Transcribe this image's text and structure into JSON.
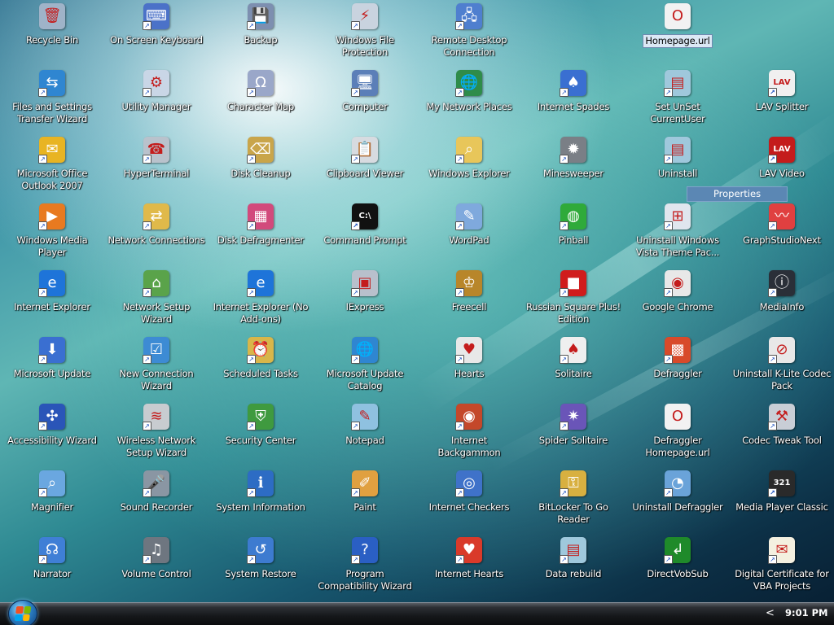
{
  "desktop": {
    "icons": [
      {
        "label": "Recycle Bin",
        "col": 0,
        "row": 0,
        "glyph": "🗑",
        "color": "#9fb3c8",
        "icon": "recycle-bin-icon",
        "shortcut": false
      },
      {
        "label": "Files and Settings Transfer Wizard",
        "col": 0,
        "row": 1,
        "glyph": "⇆",
        "color": "#2f86d1",
        "icon": "transfer-wizard-icon",
        "shortcut": true
      },
      {
        "label": "Microsoft Office Outlook 2007",
        "col": 0,
        "row": 2,
        "glyph": "✉",
        "color": "#e8b423",
        "icon": "outlook-icon",
        "shortcut": true
      },
      {
        "label": "Windows Media Player",
        "col": 0,
        "row": 3,
        "glyph": "▶",
        "color": "#e87a20",
        "icon": "media-player-icon",
        "shortcut": true
      },
      {
        "label": "Internet Explorer",
        "col": 0,
        "row": 4,
        "glyph": "e",
        "color": "#1e74d9",
        "icon": "internet-explorer-icon",
        "shortcut": true
      },
      {
        "label": "Microsoft Update",
        "col": 0,
        "row": 5,
        "glyph": "⬇",
        "color": "#3a6fd1",
        "icon": "microsoft-update-icon",
        "shortcut": true
      },
      {
        "label": "Accessibility Wizard",
        "col": 0,
        "row": 6,
        "glyph": "✣",
        "color": "#2a55b8",
        "icon": "accessibility-wizard-icon",
        "shortcut": true
      },
      {
        "label": "Magnifier",
        "col": 0,
        "row": 7,
        "glyph": "⌕",
        "color": "#6aa7e0",
        "icon": "magnifier-icon",
        "shortcut": true
      },
      {
        "label": "Narrator",
        "col": 0,
        "row": 8,
        "glyph": "☊",
        "color": "#3f7fd6",
        "icon": "narrator-icon",
        "shortcut": true
      },
      {
        "label": "On Screen Keyboard",
        "col": 1,
        "row": 0,
        "glyph": "⌨",
        "color": "#4b72c8",
        "icon": "keyboard-icon",
        "shortcut": true
      },
      {
        "label": "Utility Manager",
        "col": 1,
        "row": 1,
        "glyph": "⚙",
        "color": "#c9d6e6",
        "icon": "utility-manager-icon",
        "shortcut": true
      },
      {
        "label": "HyperTerminal",
        "col": 1,
        "row": 2,
        "glyph": "☎",
        "color": "#b9c2cc",
        "icon": "hyperterminal-icon",
        "shortcut": true
      },
      {
        "label": "Network Connections",
        "col": 1,
        "row": 3,
        "glyph": "⇄",
        "color": "#e0b94a",
        "icon": "network-connections-icon",
        "shortcut": true
      },
      {
        "label": "Network Setup Wizard",
        "col": 1,
        "row": 4,
        "glyph": "⌂",
        "color": "#5aa34a",
        "icon": "network-setup-icon",
        "shortcut": true
      },
      {
        "label": "New Connection Wizard",
        "col": 1,
        "row": 5,
        "glyph": "☑",
        "color": "#3d8bd4",
        "icon": "new-connection-icon",
        "shortcut": true
      },
      {
        "label": "Wireless Network Setup Wizard",
        "col": 1,
        "row": 6,
        "glyph": "≋",
        "color": "#c8ccd0",
        "icon": "wireless-setup-icon",
        "shortcut": true
      },
      {
        "label": "Sound Recorder",
        "col": 1,
        "row": 7,
        "glyph": "🎤",
        "color": "#8a96a3",
        "icon": "microphone-icon",
        "shortcut": true
      },
      {
        "label": "Volume Control",
        "col": 1,
        "row": 8,
        "glyph": "♫",
        "color": "#6e7680",
        "icon": "volume-control-icon",
        "shortcut": true
      },
      {
        "label": "Backup",
        "col": 2,
        "row": 0,
        "glyph": "💾",
        "color": "#7d8fb0",
        "icon": "backup-icon",
        "shortcut": true
      },
      {
        "label": "Character Map",
        "col": 2,
        "row": 1,
        "glyph": "Ω",
        "color": "#9aa7c9",
        "icon": "character-map-icon",
        "shortcut": true
      },
      {
        "label": "Disk Cleanup",
        "col": 2,
        "row": 2,
        "glyph": "⌫",
        "color": "#c9a54a",
        "icon": "disk-cleanup-icon",
        "shortcut": true
      },
      {
        "label": "Disk Defragmenter",
        "col": 2,
        "row": 3,
        "glyph": "▦",
        "color": "#d24a7c",
        "icon": "defragmenter-icon",
        "shortcut": true
      },
      {
        "label": "Internet Explorer (No Add-ons)",
        "col": 2,
        "row": 4,
        "glyph": "e",
        "color": "#1e74d9",
        "icon": "internet-explorer-icon",
        "shortcut": true
      },
      {
        "label": "Scheduled Tasks",
        "col": 2,
        "row": 5,
        "glyph": "⏰",
        "color": "#d8b64a",
        "icon": "scheduled-tasks-icon",
        "shortcut": true
      },
      {
        "label": "Security Center",
        "col": 2,
        "row": 6,
        "glyph": "⛨",
        "color": "#3f9a3f",
        "icon": "shield-icon",
        "shortcut": true
      },
      {
        "label": "System Information",
        "col": 2,
        "row": 7,
        "glyph": "ℹ",
        "color": "#2d6cc4",
        "icon": "system-information-icon",
        "shortcut": true
      },
      {
        "label": "System Restore",
        "col": 2,
        "row": 8,
        "glyph": "↺",
        "color": "#3d7bd0",
        "icon": "system-restore-icon",
        "shortcut": true
      },
      {
        "label": "Windows File Protection",
        "col": 3,
        "row": 0,
        "glyph": "⚡",
        "color": "#c9d3df",
        "icon": "file-protection-icon",
        "shortcut": true
      },
      {
        "label": "Computer",
        "col": 3,
        "row": 1,
        "glyph": "🖥",
        "color": "#5b7fb8",
        "icon": "computer-icon",
        "shortcut": true
      },
      {
        "label": "Clipboard Viewer",
        "col": 3,
        "row": 2,
        "glyph": "📋",
        "color": "#d7dbe0",
        "icon": "clipboard-icon",
        "shortcut": true
      },
      {
        "label": "Command Prompt",
        "col": 3,
        "row": 3,
        "glyph": "C:\\",
        "color": "#111111",
        "icon": "command-prompt-icon",
        "shortcut": true
      },
      {
        "label": "IExpress",
        "col": 3,
        "row": 4,
        "glyph": "▣",
        "color": "#b8c0cc",
        "icon": "iexpress-icon",
        "shortcut": true
      },
      {
        "label": "Microsoft Update Catalog",
        "col": 3,
        "row": 5,
        "glyph": "🌐",
        "color": "#2f86d1",
        "icon": "globe-icon",
        "shortcut": true
      },
      {
        "label": "Notepad",
        "col": 3,
        "row": 6,
        "glyph": "✎",
        "color": "#8fc1e0",
        "icon": "notepad-icon",
        "shortcut": true
      },
      {
        "label": "Paint",
        "col": 3,
        "row": 7,
        "glyph": "✐",
        "color": "#e0a040",
        "icon": "paint-icon",
        "shortcut": true
      },
      {
        "label": "Program Compatibility Wizard",
        "col": 3,
        "row": 8,
        "glyph": "?",
        "color": "#2a5fc4",
        "icon": "help-shield-icon",
        "shortcut": true
      },
      {
        "label": "Remote Desktop Connection",
        "col": 4,
        "row": 0,
        "glyph": "🖧",
        "color": "#4f7fcf",
        "icon": "remote-desktop-icon",
        "shortcut": true
      },
      {
        "label": "My Network Places",
        "col": 4,
        "row": 1,
        "glyph": "🌐",
        "color": "#2f8c4a",
        "icon": "network-places-icon",
        "shortcut": true
      },
      {
        "label": "Windows Explorer",
        "col": 4,
        "row": 2,
        "glyph": "⌕",
        "color": "#e8c65a",
        "icon": "explorer-icon",
        "shortcut": true
      },
      {
        "label": "WordPad",
        "col": 4,
        "row": 3,
        "glyph": "✎",
        "color": "#7fa9dd",
        "icon": "wordpad-icon",
        "shortcut": true
      },
      {
        "label": "Freecell",
        "col": 4,
        "row": 4,
        "glyph": "♔",
        "color": "#b8862a",
        "icon": "freecell-icon",
        "shortcut": true
      },
      {
        "label": "Hearts",
        "col": 4,
        "row": 5,
        "glyph": "♥",
        "color": "#e8e8e8",
        "icon": "hearts-icon",
        "shortcut": true
      },
      {
        "label": "Internet Backgammon",
        "col": 4,
        "row": 6,
        "glyph": "◉",
        "color": "#c4482a",
        "icon": "backgammon-icon",
        "shortcut": true
      },
      {
        "label": "Internet Checkers",
        "col": 4,
        "row": 7,
        "glyph": "◎",
        "color": "#3f72c9",
        "icon": "checkers-icon",
        "shortcut": true
      },
      {
        "label": "Internet Hearts",
        "col": 4,
        "row": 8,
        "glyph": "♥",
        "color": "#d93a2a",
        "icon": "internet-hearts-icon",
        "shortcut": true
      },
      {
        "label": "Internet Spades",
        "col": 5,
        "row": 1,
        "glyph": "♠",
        "color": "#3a6fd1",
        "icon": "spades-icon",
        "shortcut": true
      },
      {
        "label": "Minesweeper",
        "col": 5,
        "row": 2,
        "glyph": "✹",
        "color": "#7a7f86",
        "icon": "minesweeper-icon",
        "shortcut": true
      },
      {
        "label": "Pinball",
        "col": 5,
        "row": 3,
        "glyph": "◍",
        "color": "#2faa3a",
        "icon": "pinball-icon",
        "shortcut": true
      },
      {
        "label": "Russian Square Plus! Edition",
        "col": 5,
        "row": 4,
        "glyph": "■",
        "color": "#d01c1c",
        "icon": "russian-square-icon",
        "shortcut": true
      },
      {
        "label": "Solitaire",
        "col": 5,
        "row": 5,
        "glyph": "♠",
        "color": "#efefef",
        "icon": "solitaire-icon",
        "shortcut": true
      },
      {
        "label": "Spider Solitaire",
        "col": 5,
        "row": 6,
        "glyph": "✷",
        "color": "#6a55b8",
        "icon": "spider-solitaire-icon",
        "shortcut": true
      },
      {
        "label": "BitLocker To Go Reader",
        "col": 5,
        "row": 7,
        "glyph": "⚿",
        "color": "#d8b040",
        "icon": "bitlocker-icon",
        "shortcut": true
      },
      {
        "label": "Data rebuild",
        "col": 5,
        "row": 8,
        "glyph": "▤",
        "color": "#9fc8dc",
        "icon": "data-rebuild-icon",
        "shortcut": true
      },
      {
        "label": "Homepage.url",
        "col": 6,
        "row": 0,
        "glyph": "O",
        "color": "#f2f2f2",
        "icon": "url-shortcut-icon",
        "shortcut": false,
        "selected": true
      },
      {
        "label": "Set UnSet CurrentUser",
        "col": 6,
        "row": 1,
        "glyph": "▤",
        "color": "#9fc8dc",
        "icon": "script-file-icon",
        "shortcut": true
      },
      {
        "label": "Uninstall",
        "col": 6,
        "row": 2,
        "glyph": "▤",
        "color": "#9fc8dc",
        "icon": "uninstall-icon",
        "shortcut": true
      },
      {
        "label": "Uninstall Windows Vista Theme Pac...",
        "col": 6,
        "row": 3,
        "glyph": "⊞",
        "color": "#e0e6ee",
        "icon": "windows-logo-icon",
        "shortcut": true
      },
      {
        "label": "Google Chrome",
        "col": 6,
        "row": 4,
        "glyph": "◉",
        "color": "#e8e8e8",
        "icon": "chrome-icon",
        "shortcut": true
      },
      {
        "label": "Defraggler",
        "col": 6,
        "row": 5,
        "glyph": "▩",
        "color": "#d84a2a",
        "icon": "defraggler-icon",
        "shortcut": true
      },
      {
        "label": "Defraggler Homepage.url",
        "col": 6,
        "row": 6,
        "glyph": "O",
        "color": "#f2f2f2",
        "icon": "url-shortcut-icon",
        "shortcut": false
      },
      {
        "label": "Uninstall Defraggler",
        "col": 6,
        "row": 7,
        "glyph": "◔",
        "color": "#6aa3d9",
        "icon": "uninstall-defraggler-icon",
        "shortcut": true
      },
      {
        "label": "DirectVobSub",
        "col": 6,
        "row": 8,
        "glyph": "↲",
        "color": "#1f8a2a",
        "icon": "directvobsub-icon",
        "shortcut": true
      },
      {
        "label": "LAV Splitter",
        "col": 7,
        "row": 1,
        "glyph": "LAV",
        "color": "#f0f0f0",
        "icon": "lav-splitter-icon",
        "shortcut": true
      },
      {
        "label": "LAV Video",
        "col": 7,
        "row": 2,
        "glyph": "LAV",
        "color": "#c41c1c",
        "icon": "lav-video-icon",
        "shortcut": true
      },
      {
        "label": "GraphStudioNext",
        "col": 7,
        "row": 3,
        "glyph": "〰",
        "color": "#e04040",
        "icon": "graphstudio-icon",
        "shortcut": true
      },
      {
        "label": "MediaInfo",
        "col": 7,
        "row": 4,
        "glyph": "ⓘ",
        "color": "#2a2f38",
        "icon": "mediainfo-icon",
        "shortcut": true
      },
      {
        "label": "Uninstall K-Lite Codec Pack",
        "col": 7,
        "row": 5,
        "glyph": "⊘",
        "color": "#e8e8e8",
        "icon": "uninstall-codec-icon",
        "shortcut": true
      },
      {
        "label": "Codec Tweak Tool",
        "col": 7,
        "row": 6,
        "glyph": "⚒",
        "color": "#c9ced6",
        "icon": "tools-icon",
        "shortcut": true
      },
      {
        "label": "Media Player Classic",
        "col": 7,
        "row": 7,
        "glyph": "321",
        "color": "#2a2a2a",
        "icon": "media-player-classic-icon",
        "shortcut": true
      },
      {
        "label": "Digital Certificate for VBA Projects",
        "col": 7,
        "row": 8,
        "glyph": "✉",
        "color": "#f4f0e0",
        "icon": "certificate-icon",
        "shortcut": true
      }
    ]
  },
  "tooltip": {
    "text": "Properties"
  },
  "taskbar": {
    "clock": "9:01 PM",
    "tray_toggle": "<",
    "start_flag_colors": [
      "#f25022",
      "#7fba00",
      "#00a4ef",
      "#ffb900"
    ]
  }
}
